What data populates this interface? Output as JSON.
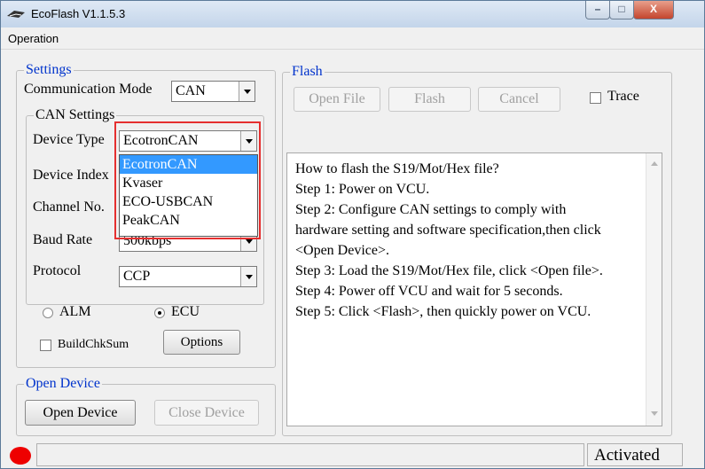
{
  "window": {
    "title": "EcoFlash V1.1.5.3",
    "min": "–",
    "max": "□",
    "close": "X"
  },
  "menu": {
    "operation": "Operation"
  },
  "settings": {
    "title": "Settings",
    "comm_mode_label": "Communication Mode",
    "comm_mode_value": "CAN",
    "can_settings_title": "CAN Settings",
    "device_type_label": "Device Type",
    "device_type_value": "EcotronCAN",
    "device_index_label": "Device Index",
    "channel_label": "Channel No.",
    "baud_rate_label": "Baud Rate",
    "baud_rate_value": "500kbps",
    "protocol_label": "Protocol",
    "protocol_value": "CCP",
    "alm_label": "ALM",
    "ecu_label": "ECU",
    "ecu_selected": true,
    "buildchksum_label": "BuildChkSum",
    "options_label": "Options"
  },
  "device_type_dropdown": {
    "items": [
      "EcotronCAN",
      "Kvaser",
      "ECO-USBCAN",
      "PeakCAN"
    ],
    "selected_index": 0,
    "highlight_color": "#e52f2f"
  },
  "open_device": {
    "title": "Open Device",
    "open_label": "Open Device",
    "close_label": "Close Device"
  },
  "flash": {
    "title": "Flash",
    "open_file_label": "Open File",
    "flash_label": "Flash",
    "cancel_label": "Cancel",
    "trace_label": "Trace",
    "instructions": [
      "How to flash the S19/Mot/Hex file?",
      "Step 1: Power on VCU.",
      "Step 2: Configure CAN settings to comply with",
      "hardware setting and software specification,then click",
      "<Open Device>.",
      "Step 3: Load the S19/Mot/Hex file, click <Open file>.",
      "Step 4: Power off VCU and wait for 5 seconds.",
      "Step 5: Click <Flash>, then quickly power on VCU."
    ]
  },
  "status": {
    "text": "Activated",
    "indicator_color": "#ee0000"
  }
}
